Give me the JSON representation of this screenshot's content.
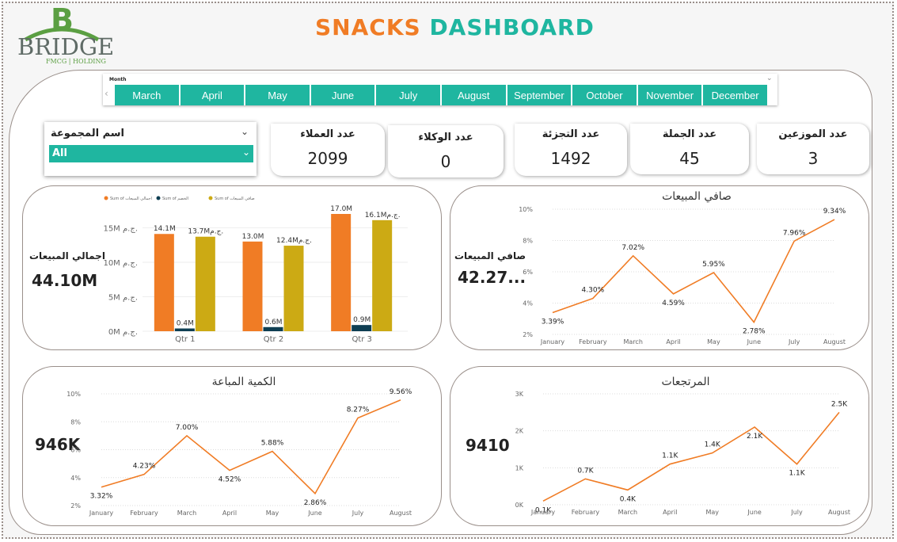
{
  "header": {
    "logo": {
      "text": "BRIDGE",
      "sub": "FMCG | HOLDING"
    },
    "title_part1": "SNACKS",
    "title_part2": "DASHBOARD",
    "colors": {
      "orange": "#f07c25",
      "teal": "#1fb6a0",
      "olive": "#ccaa14",
      "navy": "#0e3e52"
    }
  },
  "month_slicer": {
    "label": "Month",
    "months": [
      "March",
      "April",
      "May",
      "June",
      "July",
      "August",
      "September",
      "October",
      "November",
      "December"
    ]
  },
  "group_filter": {
    "label": "اسم المجموعة",
    "value": "All"
  },
  "cards": [
    {
      "label": "عدد الموزعين",
      "value": "3"
    },
    {
      "label": "عدد الجملة",
      "value": "45"
    },
    {
      "label": "عدد التجزئة",
      "value": "1492"
    },
    {
      "label": "عدد الوكلاء",
      "value": "0"
    },
    {
      "label": "عدد العملاء",
      "value": "2099"
    }
  ],
  "kpis": {
    "gross_sales": {
      "label": "اجمالي المبيعات",
      "value": "44.10M"
    },
    "net_sales": {
      "label": "صافي المبيعات",
      "value": "42.27..."
    },
    "quantity": {
      "value": "946K"
    },
    "returns": {
      "value": "9410"
    }
  },
  "chart_data": [
    {
      "type": "bar",
      "title": "",
      "legend": [
        "Sum of اجمالي المبيعات",
        "Sum of الخصم",
        "Sum of صافي المبيعات"
      ],
      "categories": [
        "Qtr 1",
        "Qtr 2",
        "Qtr 3"
      ],
      "series": [
        {
          "name": "Sum of اجمالي المبيعات",
          "values": [
            14.1,
            13.0,
            17.0
          ],
          "labels": [
            "14.1M",
            "13.0M",
            "17.0M"
          ]
        },
        {
          "name": "Sum of الخصم",
          "values": [
            0.4,
            0.6,
            0.9
          ],
          "labels": [
            "0.4M",
            "0.6M",
            "0.9M"
          ]
        },
        {
          "name": "Sum of صافي المبيعات",
          "values": [
            13.7,
            12.4,
            16.1
          ],
          "labels": [
            "13.7Mج.م.",
            "12.4Mج.م.",
            "16.1Mج.م."
          ]
        }
      ],
      "yticks": [
        "0M ج.م.",
        "5M ج.م.",
        "10M ج.م.",
        "15M ج.م."
      ],
      "ylim": [
        0,
        17
      ]
    },
    {
      "type": "line",
      "title": "صافي المبيعات",
      "x": [
        "January",
        "February",
        "March",
        "April",
        "May",
        "June",
        "July",
        "August"
      ],
      "values": [
        3.39,
        4.3,
        7.02,
        4.59,
        5.95,
        2.78,
        7.96,
        9.34
      ],
      "labels": [
        "3.39%",
        "4.30%",
        "7.02%",
        "4.59%",
        "5.95%",
        "2.78%",
        "7.96%",
        "9.34%"
      ],
      "yticks": [
        "2%",
        "4%",
        "6%",
        "8%",
        "10%"
      ],
      "ylim": [
        2,
        10
      ]
    },
    {
      "type": "line",
      "title": "الكمية المباعة",
      "x": [
        "January",
        "February",
        "March",
        "April",
        "May",
        "June",
        "July",
        "August"
      ],
      "values": [
        3.32,
        4.23,
        7.0,
        4.52,
        5.88,
        2.86,
        8.27,
        9.56
      ],
      "labels": [
        "3.32%",
        "4.23%",
        "7.00%",
        "4.52%",
        "5.88%",
        "2.86%",
        "8.27%",
        "9.56%"
      ],
      "yticks": [
        "2%",
        "4%",
        "6%",
        "8%",
        "10%"
      ],
      "ylim": [
        2,
        10
      ]
    },
    {
      "type": "line",
      "title": "المرتجعات",
      "x": [
        "January",
        "February",
        "March",
        "April",
        "May",
        "June",
        "July",
        "August"
      ],
      "values": [
        0.1,
        0.7,
        0.4,
        1.1,
        1.4,
        2.1,
        1.1,
        2.5
      ],
      "labels": [
        "0.1K",
        "0.7K",
        "0.4K",
        "1.1K",
        "1.4K",
        "2.1K",
        "1.1K",
        "2.5K"
      ],
      "yticks": [
        "0K",
        "1K",
        "2K",
        "3K"
      ],
      "ylim": [
        0,
        3
      ]
    }
  ]
}
